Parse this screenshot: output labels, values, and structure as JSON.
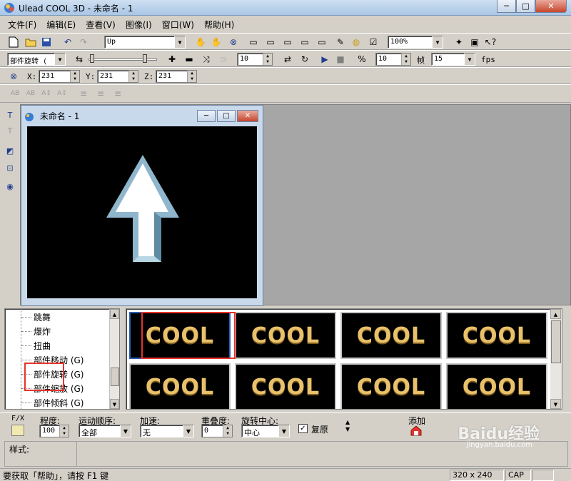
{
  "app": {
    "title": "Ulead COOL 3D - 未命名 - 1",
    "window_controls": {
      "minimize": "─",
      "restore": "□",
      "close": "✕"
    }
  },
  "menu": [
    "文件(F)",
    "编辑(E)",
    "查看(V)",
    "图像(I)",
    "窗口(W)",
    "帮助(H)"
  ],
  "toolbar1": {
    "object_combo": "Up",
    "zoom_combo": "100%"
  },
  "toolbar2": {
    "effect_combo": "部件旋转",
    "effect_combo_suffix": "(",
    "value1": "10",
    "value2": "10",
    "frame_label": "帧",
    "fps_value": "15",
    "fps_label": "fps"
  },
  "toolbar3": {
    "x_label": "X:",
    "x_value": "231",
    "y_label": "Y:",
    "y_value": "231",
    "z_label": "Z:",
    "z_value": "231"
  },
  "document": {
    "title": "未命名 - 1"
  },
  "tree": {
    "items": [
      "跳舞",
      "爆炸",
      "扭曲",
      "部件移动 (G)",
      "部件旋转 (G)",
      "部件缩放 (G)",
      "部件倾斜 (G)"
    ]
  },
  "gallery": {
    "thumbs": [
      "COOL",
      "COOL",
      "COOL",
      "COOL",
      "COOL",
      "COOL",
      "COOL",
      "COOL"
    ]
  },
  "properties": {
    "fx_label": "F/X",
    "degree_label": "程度:",
    "degree_value": "100",
    "order_label": "运动顺序:",
    "order_value": "全部",
    "accel_label": "加速:",
    "accel_value": "无",
    "overlap_label": "重叠度:",
    "overlap_value": "0",
    "center_label": "旋转中心:",
    "center_value": "中心",
    "restore_label": "复原",
    "add_label": "添加"
  },
  "style_bar": {
    "label": "样式:"
  },
  "status": {
    "hint": "要获取「帮助」，请按 F1 键",
    "size": "320 x 240",
    "caps": "CAP"
  },
  "watermark": {
    "text": "Baidu经验",
    "sub": "jingyan.baidu.com"
  },
  "colors": {
    "accent": "#2a5db0",
    "highlight_box": "#e8332a",
    "text_gold": "#e8c16a"
  }
}
